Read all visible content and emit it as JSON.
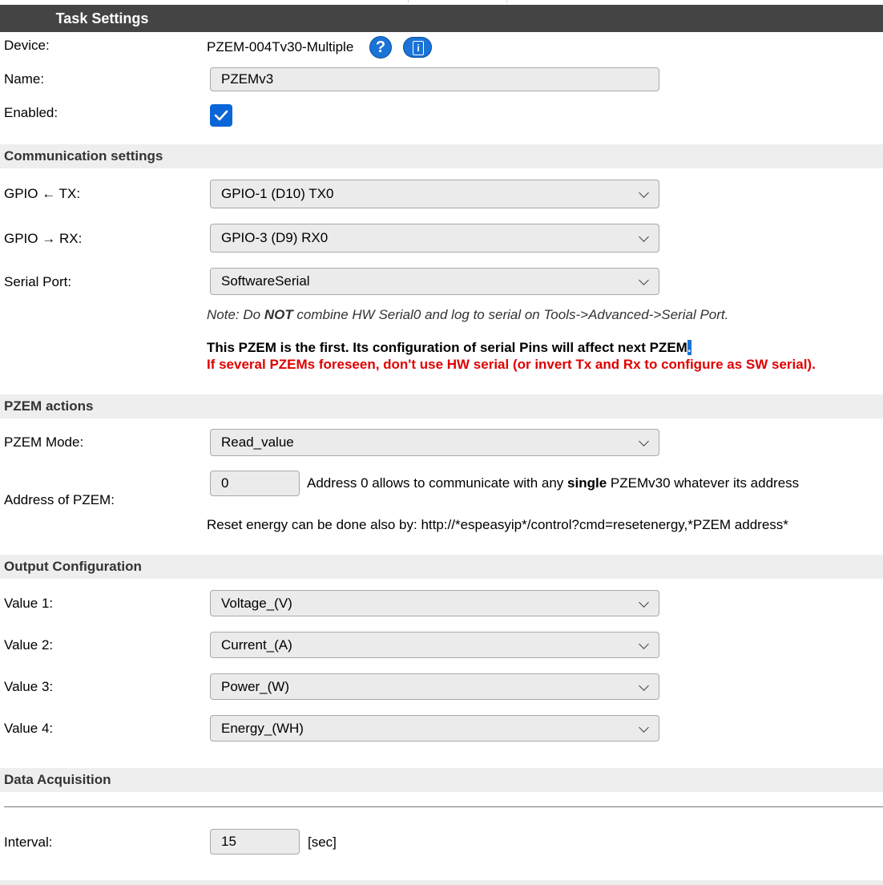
{
  "header": {
    "title": "Task Settings"
  },
  "device": {
    "label": "Device:",
    "value": "PZEM-004Tv30-Multiple",
    "help_icon": "question-icon",
    "info_icon": "info-icon",
    "help_glyph": "?",
    "info_glyph": "i"
  },
  "name": {
    "label": "Name:",
    "value": "PZEMv3"
  },
  "enabled": {
    "label": "Enabled:",
    "checked": true
  },
  "communication": {
    "title": "Communication settings",
    "gpio_tx": {
      "label": "GPIO ← TX:",
      "value": "GPIO-1 (D10) TX0"
    },
    "gpio_rx": {
      "label": "GPIO → RX:",
      "value": "GPIO-3 (D9) RX0"
    },
    "serial_port": {
      "label": "Serial Port:",
      "value": "SoftwareSerial"
    },
    "note_pre": "Note: Do ",
    "note_bold": "NOT",
    "note_post": " combine HW Serial0 and log to serial on Tools->Advanced->Serial Port.",
    "warning_black": "This PZEM is the first. Its configuration of serial Pins will affect next PZEM",
    "warning_black_end": ".",
    "warning_red": "If several PZEMs foreseen, don't use HW serial (or invert Tx and Rx to configure as SW serial)."
  },
  "pzem_actions": {
    "title": "PZEM actions",
    "mode": {
      "label": "PZEM Mode:",
      "value": "Read_value"
    },
    "address": {
      "label": "Address of PZEM:",
      "value": "0",
      "hint_pre": "Address 0 allows to communicate with any ",
      "hint_bold": "single",
      "hint_post": " PZEMv30 whatever its address"
    },
    "reset_note": "Reset energy can be done also by: http://*espeasyip*/control?cmd=resetenergy,*PZEM address*"
  },
  "output": {
    "title": "Output Configuration",
    "values": [
      {
        "label": "Value 1:",
        "value": "Voltage_(V)"
      },
      {
        "label": "Value 2:",
        "value": "Current_(A)"
      },
      {
        "label": "Value 3:",
        "value": "Power_(W)"
      },
      {
        "label": "Value 4:",
        "value": "Energy_(WH)"
      }
    ]
  },
  "data_acquisition": {
    "title": "Data Acquisition",
    "interval": {
      "label": "Interval:",
      "value": "15",
      "unit": "[sec]"
    }
  },
  "colors": {
    "header_bg": "#444444",
    "section_bg": "#eeeeee",
    "accent": "#1a73d6",
    "warning": "#e00000"
  }
}
